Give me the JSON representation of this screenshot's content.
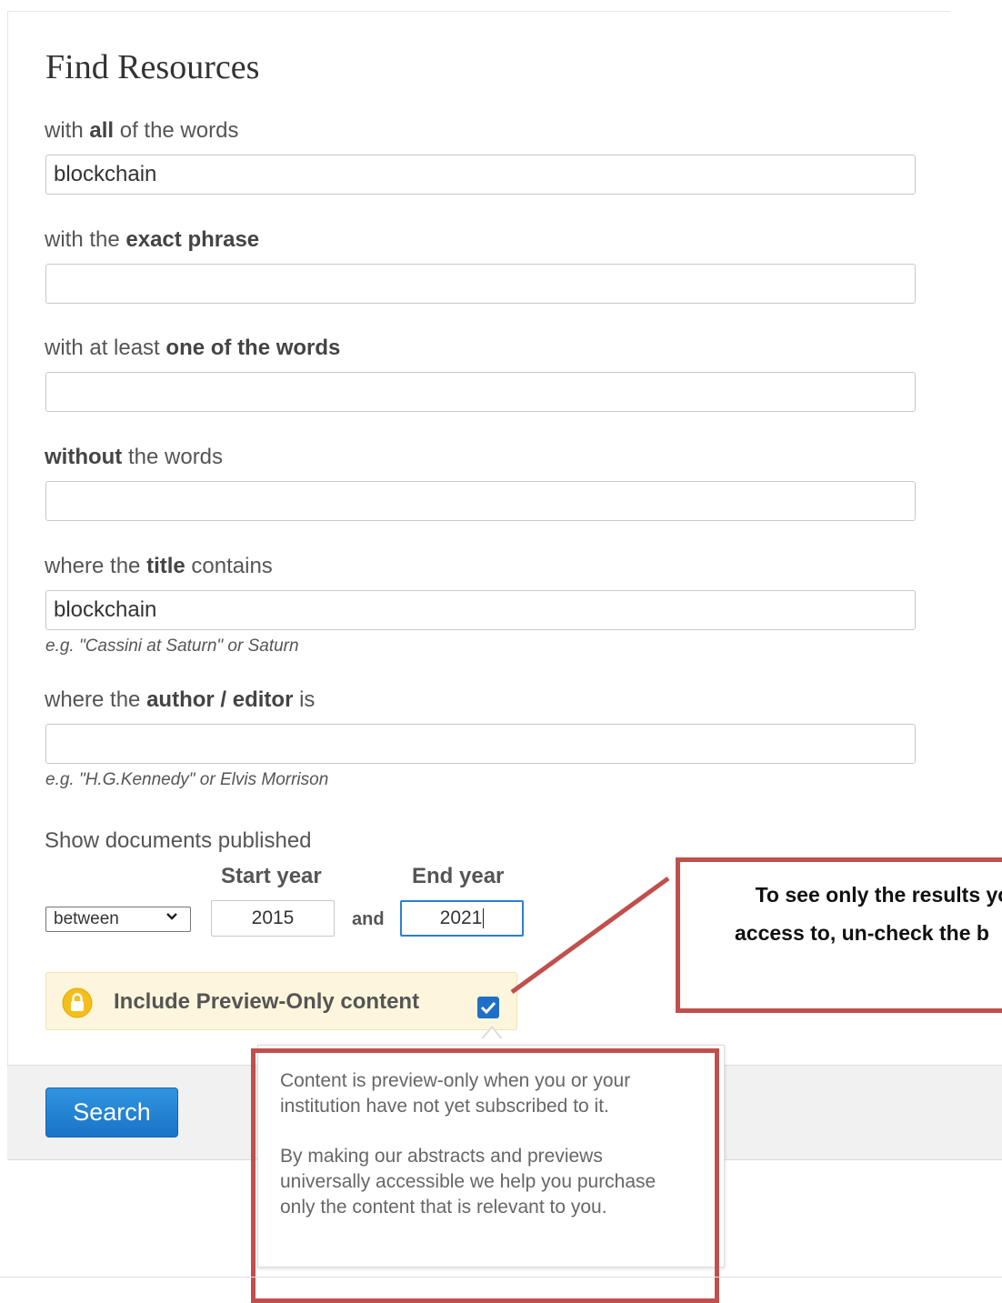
{
  "form": {
    "title": "Find Resources",
    "all_words": {
      "pre": "with ",
      "bold": "all",
      "post": " of the words",
      "value": "blockchain"
    },
    "exact_phrase": {
      "pre": "with the ",
      "bold": "exact phrase",
      "post": "",
      "value": ""
    },
    "one_of": {
      "pre": "with at least ",
      "bold": "one of the words",
      "post": "",
      "value": ""
    },
    "without": {
      "pre": "",
      "bold": "without",
      "post": " the words",
      "value": ""
    },
    "title_contains": {
      "pre": "where the ",
      "bold": "title",
      "post": " contains",
      "value": "blockchain",
      "hint": "e.g. \"Cassini at Saturn\" or Saturn"
    },
    "author": {
      "pre": "where the ",
      "bold": "author / editor",
      "post": " is",
      "value": "",
      "hint": "e.g. \"H.G.Kennedy\" or Elvis Morrison"
    },
    "published": {
      "label": "Show documents published",
      "start_header": "Start year",
      "end_header": "End year",
      "range_select": "between",
      "start_year": "2015",
      "and_label": "and",
      "end_year": "2021"
    },
    "preview": {
      "label": "Include Preview-Only content",
      "checked": true
    },
    "search_label": "Search"
  },
  "tooltip": {
    "para1": "Content is preview-only when you or your institution have not yet subscribed to it.",
    "para2": "By making our abstracts and previews universally accessible we help you purchase only the content that is relevant to you."
  },
  "callout": {
    "line1": "To see only the results you",
    "line2": "access to, un-check the b"
  },
  "colors": {
    "accent": "#1f6fc9",
    "annotation": "#c0504d",
    "preview_bg": "#fdf6dc"
  }
}
